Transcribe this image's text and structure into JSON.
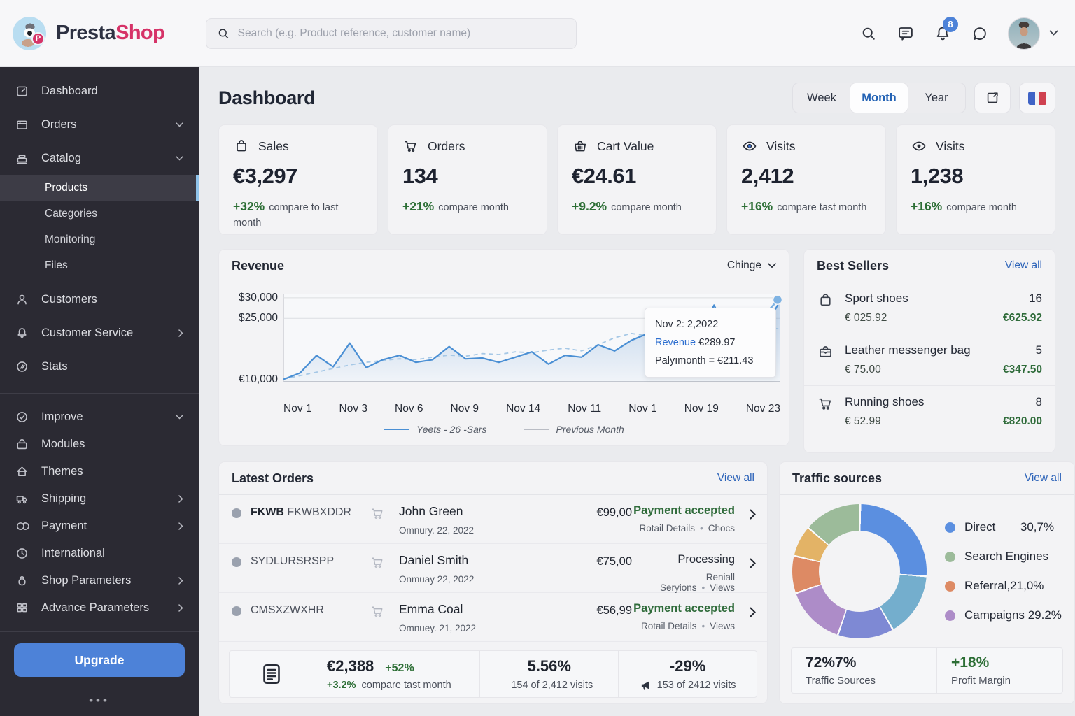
{
  "topbar": {
    "logo": {
      "presta": "Presta",
      "shop": "Shop",
      "badge": "P"
    },
    "search_placeholder": "Search (e.g. Product reference, customer name)",
    "notification_count": "8"
  },
  "sidebar": {
    "items": [
      {
        "label": "Dashboard"
      },
      {
        "label": "Orders",
        "chevron": "down"
      },
      {
        "label": "Catalog",
        "chevron": "down"
      },
      {
        "label": "Products",
        "sub": true,
        "active": true
      },
      {
        "label": "Categories",
        "sub": true
      },
      {
        "label": "Monitoring",
        "sub": true
      },
      {
        "label": "Files",
        "sub": true
      },
      {
        "label": "Customers"
      },
      {
        "label": "Customer Service",
        "chevron": "right"
      },
      {
        "label": "Stats"
      },
      {
        "label": "Improve",
        "chevron": "down"
      },
      {
        "label": "Modules"
      },
      {
        "label": "Themes"
      },
      {
        "label": "Shipping",
        "chevron": "right"
      },
      {
        "label": "Payment",
        "chevron": "right"
      },
      {
        "label": "International"
      },
      {
        "label": "Shop Parameters",
        "chevron": "right"
      },
      {
        "label": "Advance Parameters",
        "chevron": "right"
      }
    ],
    "upgrade_label": "Upgrade",
    "more_dots": "•••"
  },
  "header": {
    "title": "Dashboard",
    "range_tabs": [
      "Week",
      "Month",
      "Year"
    ],
    "active_tab": "Month"
  },
  "kpi_cards": [
    {
      "icon": "bag-icon",
      "title": "Sales",
      "value": "€3,297",
      "delta": "+32%",
      "note": "compare to last month"
    },
    {
      "icon": "cart-icon",
      "title": "Orders",
      "value": "134",
      "delta": "+21%",
      "note": "compare month"
    },
    {
      "icon": "basket-icon",
      "title": "Cart Value",
      "value": "€24.61",
      "delta": "+9.2%",
      "note": "compare month"
    },
    {
      "icon": "eye-icon",
      "title": "Visits",
      "value": "2,412",
      "delta": "+16%",
      "note": "compare tast month"
    },
    {
      "icon": "eye-icon",
      "title": "Visits",
      "value": "1,238",
      "delta": "+16%",
      "note": "compare month"
    }
  ],
  "revenue": {
    "title": "Revenue",
    "dropdown_label": "Chinge"
  },
  "best_sellers": {
    "title": "Best Sellers",
    "view_all": "View all",
    "items": [
      {
        "icon": "bag-icon",
        "name": "Sport shoes",
        "price": "€ 025.92",
        "qty": "16",
        "total": "€625.92"
      },
      {
        "icon": "briefcase-icon",
        "name": "Leather messenger bag",
        "price": "€ 75.00",
        "qty": "5",
        "total": "€347.50"
      },
      {
        "icon": "cart-icon",
        "name": "Running shoes",
        "price": "€ 52.99",
        "qty": "8",
        "total": "€820.00"
      }
    ]
  },
  "latest_orders": {
    "title": "Latest Orders",
    "view_all": "View all",
    "bullet": "•",
    "rows": [
      {
        "ref_bold": "FKWB",
        "ref": " FKWBXDDR",
        "customer": "John Green",
        "date": "Omnury. 22, 2022",
        "amount": "€99,00",
        "status": "Payment accepted",
        "status_color": "green",
        "link1": "Rotail Details",
        "link2": "Chocs"
      },
      {
        "ref_bold": "",
        "ref": "SYDLURSRSPP",
        "customer": "Daniel Smith",
        "date": "Onmuay 22, 2022",
        "amount": "€75,00",
        "status": "Processing",
        "status_color": "dark",
        "link1": "Reniall Seryions",
        "link2": "Views"
      },
      {
        "ref_bold": "",
        "ref": "CMSXZWXHR",
        "customer": "Emma Coal",
        "date": "Omnuey. 21, 2022",
        "amount": "€56,99",
        "status": "Payment accepted",
        "status_color": "green",
        "link1": "Rotail Details",
        "link2": "Views"
      }
    ],
    "footer": {
      "sales_value": "€2,388",
      "sales_delta": "+52%",
      "sales_sub_delta": "+3.2%",
      "sales_sub_note": "compare tast month",
      "conversion_value": "5.56%",
      "conversion_note": "154 of 2,412 visits",
      "abandoned_value": "-29%",
      "abandoned_note": "153 of 2412 visits"
    }
  },
  "traffic": {
    "title": "Traffic sources",
    "view_all": "View all",
    "footer": {
      "left_value": "72%7%",
      "left_label": "Traffic Sources",
      "right_value": "+18%",
      "right_label": "Profit Margin"
    }
  },
  "colors": {
    "brand_pink": "#d63368",
    "brand_navy": "#2d3142",
    "accent_blue": "#2b62b8",
    "positive_green": "#2c6e35",
    "sidebar_bg": "#2b2a33",
    "upgrade_blue": "#4d82d8",
    "active_item_highlight": "#8fc3ea",
    "chart_line_blue": "#4a8fd4",
    "badge_blue": "#4d82d8"
  },
  "chart_data": [
    {
      "type": "area",
      "title": "Revenue",
      "x_ticks": [
        "Nov 1",
        "Nov 3",
        "Nov 6",
        "Nov 9",
        "Nov 14",
        "Nov 11",
        "Nov 1",
        "Nov 19",
        "Nov 23"
      ],
      "y_ticks": [
        "$30,000",
        "$25,000",
        "€10,000"
      ],
      "ylim": [
        9500,
        31000
      ],
      "y_gridlines": [
        30000,
        25000
      ],
      "grid": true,
      "legend_position": "bottom",
      "series": [
        {
          "name": "Yeets - 26 -Sars",
          "style": "solid",
          "color": "#4a8fd4",
          "legend_color": "#4a8fd4",
          "values": [
            10100,
            11650,
            15950,
            13150,
            18950,
            12950,
            14900,
            15950,
            14250,
            14900,
            18100,
            15100,
            15300,
            14250,
            15500,
            16800,
            13800,
            15950,
            15500,
            18550,
            17050,
            19600,
            21300,
            19400,
            23050,
            20250,
            28200,
            19600,
            22400,
            21750,
            29500
          ]
        },
        {
          "name": "Previous Month",
          "style": "dashed",
          "color": "#a6c8e6",
          "legend_color": "#b9bcc4",
          "values": [
            10150,
            11000,
            11850,
            12750,
            13600,
            14250,
            14700,
            15100,
            14900,
            15500,
            16000,
            15750,
            16400,
            16150,
            16800,
            16600,
            17250,
            17700,
            17050,
            18550,
            20250,
            21300,
            20700,
            21750,
            20900,
            21950,
            21300,
            22400,
            21750,
            22800,
            22400
          ]
        }
      ],
      "tooltip": {
        "date": "Nov 2: 2,2022",
        "revenue_label": "Revenue",
        "revenue_value": "€289.97",
        "payline": "Palyımonth = €211.43"
      }
    },
    {
      "type": "pie",
      "donut": true,
      "title": "Traffic sources",
      "slices": [
        {
          "label": "Direct",
          "value": 26,
          "color": "#5b8fe0"
        },
        {
          "label": "Other (teal)",
          "value": 15.5,
          "color": "#74aecd"
        },
        {
          "label": "Other (indigo)",
          "value": 13.5,
          "color": "#7e89d4"
        },
        {
          "label": "Campaigns",
          "value": 14.5,
          "color": "#ad8cc8"
        },
        {
          "label": "Referral",
          "value": 9,
          "color": "#dd8a64"
        },
        {
          "label": "Other (gold)",
          "value": 7.5,
          "color": "#e3b366"
        },
        {
          "label": "Search Engines",
          "value": 14,
          "color": "#9cbb9a"
        }
      ],
      "legend": [
        {
          "label": "Direct",
          "value": "30,7%",
          "color": "#5b8fe0"
        },
        {
          "label": "Search Engines",
          "value": "",
          "color": "#9cbb9a"
        },
        {
          "label": "Referral,21,0%",
          "value": "",
          "color": "#dd8a64"
        },
        {
          "label": "Campaigns 29.2%",
          "value": "",
          "color": "#ad8cc8"
        }
      ]
    }
  ]
}
